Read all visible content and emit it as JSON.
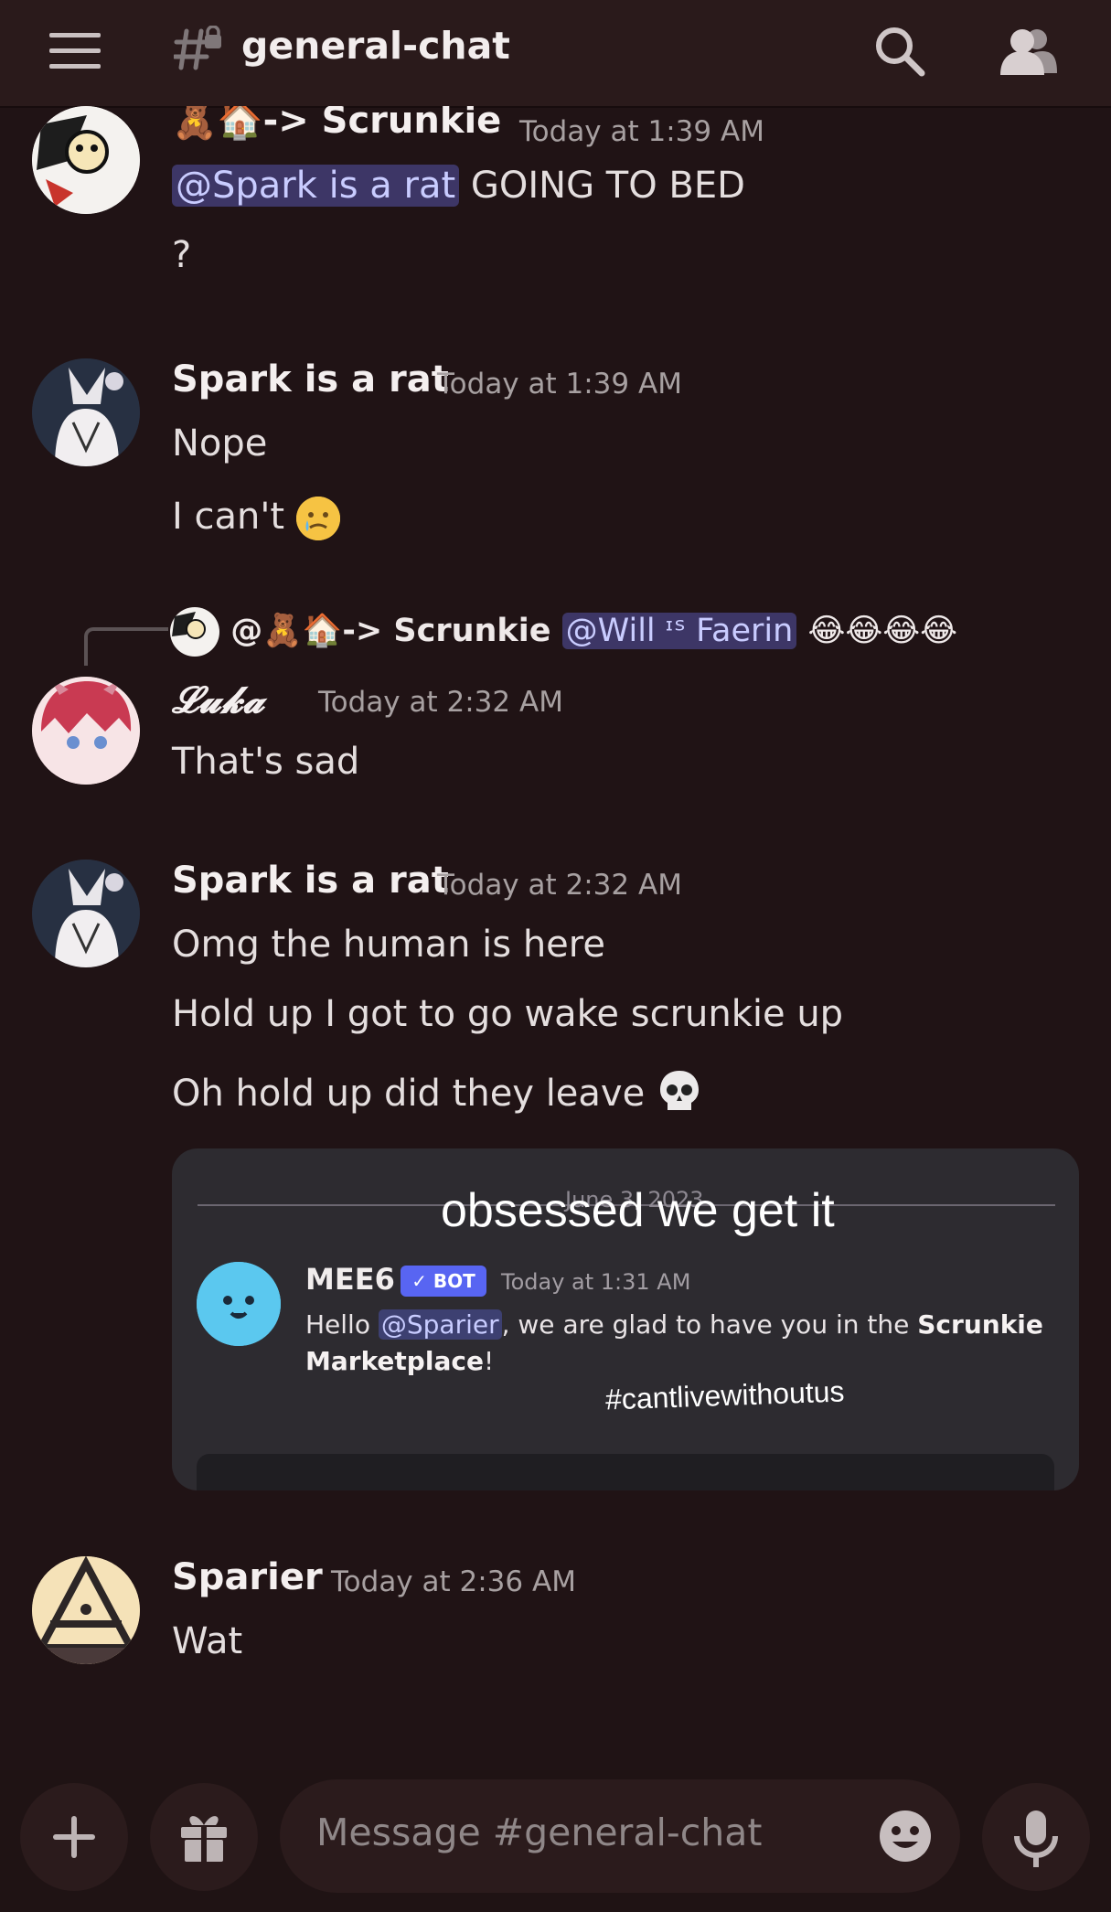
{
  "header": {
    "channel_name": "general-chat"
  },
  "messages": [
    {
      "username": "🧸🏠-> Scrunkie",
      "timestamp": "Today at 1:39 AM",
      "lines": [
        "GOING TO BED",
        "?"
      ],
      "mention": "@Spark is a rat"
    },
    {
      "username": "Spark is a rat",
      "timestamp": "Today at 1:39 AM",
      "lines": [
        "Nope",
        "I can't"
      ]
    },
    {
      "reply": {
        "author": "@🧸🏠-> Scrunkie",
        "mention": "@Will ᶦˢ Faerin",
        "emoji": "😂😂😂😂"
      },
      "username": "𝓛𝓾𝓴𝓪",
      "timestamp": "Today at 2:32 AM",
      "lines": [
        "That's sad"
      ]
    },
    {
      "username": "Spark is a rat",
      "timestamp": "Today at 2:32 AM",
      "lines": [
        "Omg the human is here",
        "Hold up I got to go wake scrunkie up",
        "Oh hold up did they leave"
      ]
    },
    {
      "username": "Sparier",
      "timestamp": "Today at 2:36 AM",
      "lines": [
        "Wat"
      ]
    }
  ],
  "embed": {
    "overlay_text": "obsessed we get it",
    "faded_date": "June 3, 2023",
    "user": "MEE6",
    "badge": "BOT",
    "time": "Today at 1:31 AM",
    "line1_pre": "Hello ",
    "line1_mention": "@Sparier",
    "line1_post": ", we are glad to have you in the ",
    "line1_bold": "Scrunkie",
    "line2_bold": "Marketplace",
    "line2_post": "!",
    "hashtag": "#cantlivewithoutus"
  },
  "composer": {
    "placeholder": "Message #general-chat"
  },
  "icons": {
    "menu": "hamburger-menu-icon",
    "channel": "locked-hashtag-icon",
    "search": "search-icon",
    "members": "members-icon",
    "plus": "plus-icon",
    "gift": "gift-icon",
    "emoji": "smile-icon",
    "mic": "microphone-icon"
  }
}
